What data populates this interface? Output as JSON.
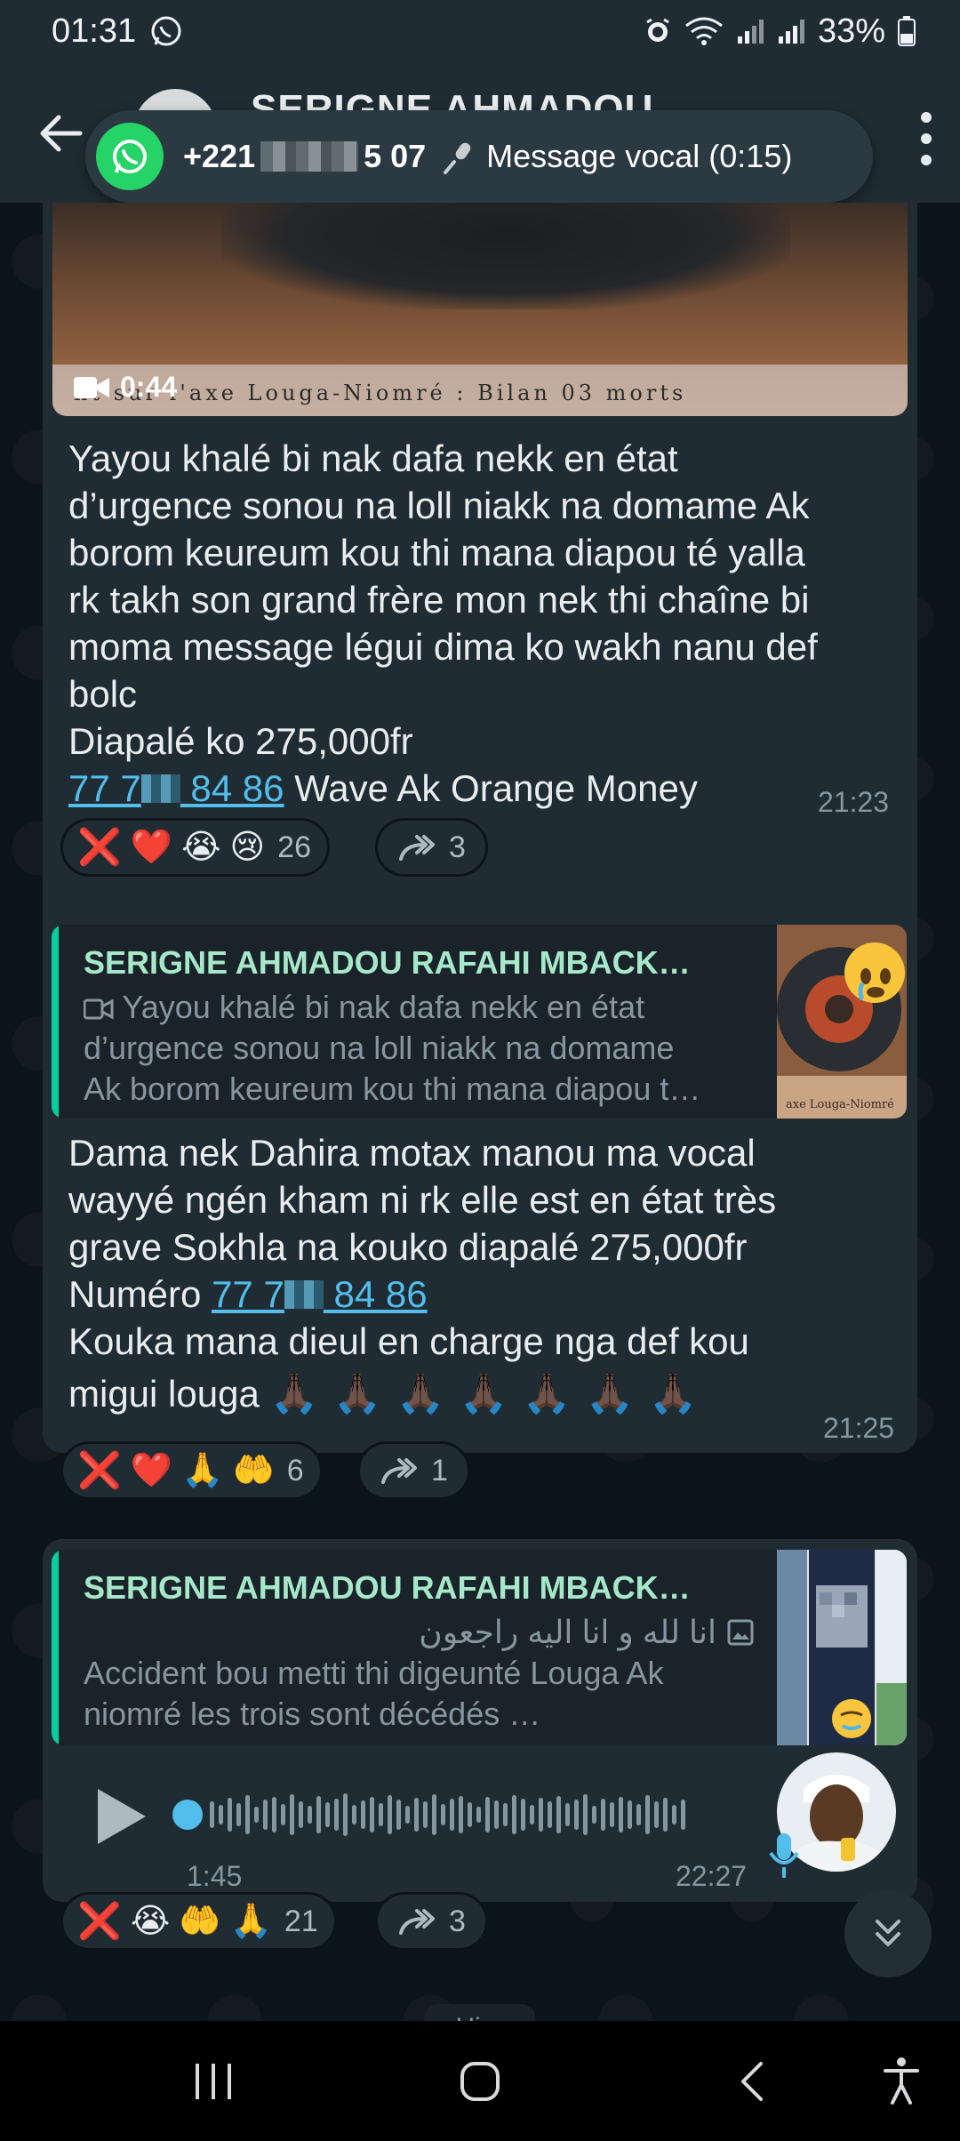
{
  "status_bar": {
    "time": "01:31",
    "battery": "33%"
  },
  "header": {
    "title": "SERIGNE AHMADOU"
  },
  "call_pill": {
    "phone_prefix": "+221",
    "phone_suffix": "5 07",
    "message": "Message vocal (0:15)"
  },
  "message1": {
    "video_duration": "0:44",
    "ticker": "nt sur l'axe Louga-Niomré : Bilan 03 morts",
    "lines": [
      "Yayou khalé bi nak dafa nekk en état",
      "d’urgence sonou na loll niakk na domame Ak",
      "borom keureum kou thi mana diapou té yalla",
      "rk takh son grand frère mon nek thi chaîne bi",
      "moma message légui dima ko wakh nanu def",
      "bolc",
      "Diapalé ko 275,000fr"
    ],
    "phone_a": "77 7",
    "phone_b": "84 86",
    "after_phone": "Wave Ak Orange Money",
    "time": "21:23",
    "reactions": [
      "❌",
      "❤️",
      "😭",
      "😢"
    ],
    "reaction_count": "26",
    "forward_count": "3"
  },
  "message2": {
    "quote_author": "SERIGNE AHMADOU RAFAHI MBACK…",
    "quote_lines": [
      "Yayou khalé bi nak dafa nekk en état",
      "d’urgence sonou na loll niakk na domame",
      "Ak borom keureum kou thi mana diapou t…"
    ],
    "lines": [
      "Dama nek Dahira motax manou ma vocal",
      "wayyé ngén kham ni rk elle est en état très",
      "grave Sokhla na kouko diapalé 275,000fr"
    ],
    "numero_label": "Numéro",
    "phone_a": "77 7",
    "phone_b": "84 86",
    "lines2": [
      "Kouka mana dieul en charge nga def kou",
      "migui louga"
    ],
    "pray_emojis": "🙏🏿 🙏🏿 🙏🏿 🙏🏿 🙏🏿 🙏🏿 🙏🏿",
    "time": "21:25",
    "reactions": [
      "❌",
      "❤️",
      "🙏",
      "🤲"
    ],
    "reaction_count": "6",
    "forward_count": "1"
  },
  "message3": {
    "quote_author": "SERIGNE AHMADOU RAFAHI MBACK…",
    "quote_arabic": "انا لله و انا اليه راجعون",
    "quote_lines": [
      "Accident bou metti thi digeunté Louga Ak",
      "niomré les trois sont décédés …"
    ],
    "voice_duration": "1:45",
    "time": "22:27",
    "reactions": [
      "❌",
      "😭",
      "🤲",
      "🙏"
    ],
    "reaction_count": "21",
    "forward_count": "3"
  },
  "date_chip": "Hier",
  "colors": {
    "accent_green": "#25d366",
    "bubble": "#202c33",
    "link": "#53bdeb",
    "quote_bar": "#06cf9c"
  },
  "icons": [
    "back-arrow-icon",
    "whatsapp-icon",
    "microphone-icon",
    "menu-dots-icon",
    "video-camera-icon",
    "forward-icon",
    "play-icon",
    "mic-icon",
    "scroll-down-icon",
    "image-icon",
    "recents-icon",
    "home-icon",
    "back-icon",
    "accessibility-icon"
  ]
}
